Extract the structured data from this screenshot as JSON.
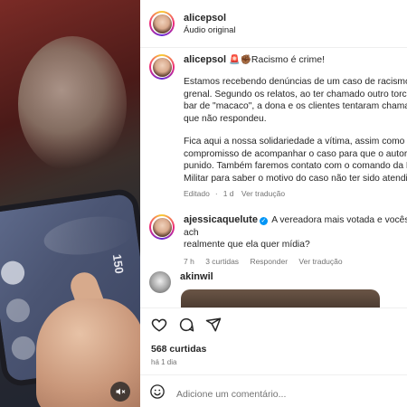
{
  "post": {
    "username": "alicepsol",
    "audio": "Áudio original"
  },
  "caption": {
    "username": "alicepsol",
    "headline": "Racismo é crime!",
    "paragraph1": "Estamos recebendo denúncias de um caso de racismo o\ngrenal. Segundo os relatos, ao ter chamado outro torce\nbar de \"macaco\", a dona e os clientes tentaram chamar\nque não respondeu.",
    "paragraph2": "Fica aqui a nossa solidariedade a vítima, assim como o n\ncompromisso de acompanhar o caso para que o autor s\npunido. Também faremos contato com o comando da B\nMilitar para saber o motivo do caso não ter sido atendid",
    "edited": "Editado",
    "age": "1 d",
    "see_translation": "Ver tradução"
  },
  "comments": [
    {
      "username": "ajessicaquelute",
      "verified": true,
      "text": "A vereadora mais votada e vocês ach\nrealmente que ela quer mídia?",
      "age": "7 h",
      "likes": "3 curtidas",
      "reply": "Responder",
      "see_translation": "Ver tradução"
    },
    {
      "username": "akinwil"
    }
  ],
  "actions": {
    "likes_count": "568 curtidas",
    "time": "há 1 dia"
  },
  "add_comment": {
    "placeholder": "Adicione um comentário..."
  },
  "icons": {
    "like": "heart-icon",
    "comment": "comment-icon",
    "share": "send-icon",
    "emoji": "emoji-icon",
    "mute": "speaker-muted-icon"
  },
  "colors": {
    "verified": "#0095f6",
    "secondary_text": "#737373"
  }
}
